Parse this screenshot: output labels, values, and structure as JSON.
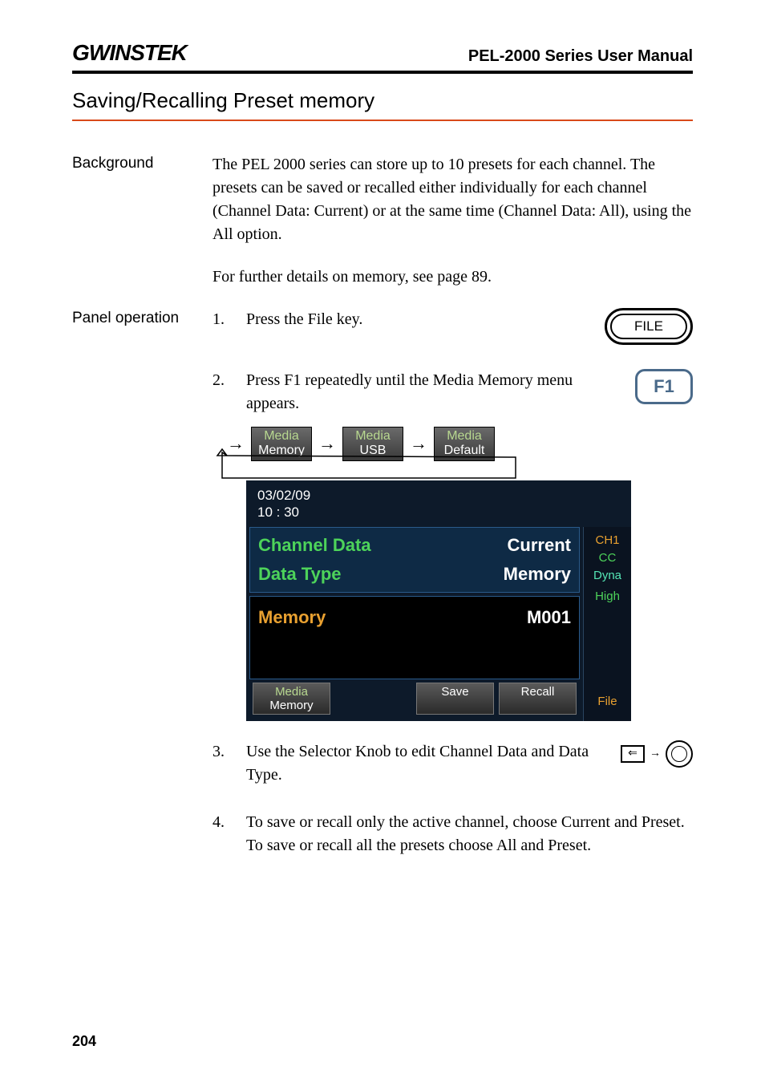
{
  "header": {
    "logo": "GWINSTEK",
    "manual": "PEL-2000 Series User Manual"
  },
  "section_title": "Saving/Recalling Preset memory",
  "rows": {
    "background_label": "Background",
    "background_text1": "The PEL 2000 series can store up to 10 presets for each channel. The presets can be saved or recalled either individually for each channel (Channel Data: Current) or at the same time (Channel Data: All), using the All option.",
    "background_text2": "For further details on memory, see page 89.",
    "panel_label": "Panel operation"
  },
  "steps": {
    "s1_num": "1.",
    "s1_text": "Press the File key.",
    "s2_num": "2.",
    "s2_text": "Press F1 repeatedly until the Media Memory menu appears.",
    "s3_num": "3.",
    "s3_text": "Use the Selector Knob to edit Channel Data and Data Type.",
    "s4_num": "4.",
    "s4_text": "To save or recall only the active channel, choose Current and Preset. To save or recall all the presets choose All and Preset."
  },
  "buttons": {
    "file": "FILE",
    "f1": "F1"
  },
  "media_cycle": {
    "m1_top": "Media",
    "m1_bot": "Memory",
    "m2_top": "Media",
    "m2_bot": "USB",
    "m3_top": "Media",
    "m3_bot": "Default"
  },
  "screen": {
    "date": "03/02/09",
    "time": "10 : 30",
    "channel_data_label": "Channel Data",
    "channel_data_value": "Current",
    "data_type_label": "Data Type",
    "data_type_value": "Memory",
    "memory_label": "Memory",
    "memory_value": "M001",
    "side": {
      "ch": "CH1",
      "mode": "CC",
      "dyna": "Dyna",
      "range": "High",
      "file": "File"
    },
    "softkeys": {
      "k1_top": "Media",
      "k1_bot": "Memory",
      "k2": "Save",
      "k3": "Recall"
    }
  },
  "page_number": "204"
}
